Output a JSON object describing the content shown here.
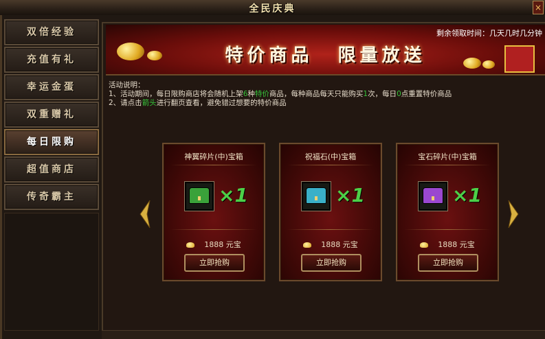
{
  "window": {
    "title": "全民庆典",
    "close_label": "×"
  },
  "sidebar": {
    "items": [
      {
        "label": "双倍经验",
        "active": false
      },
      {
        "label": "充值有礼",
        "active": false
      },
      {
        "label": "幸运金蛋",
        "active": false
      },
      {
        "label": "双重赠礼",
        "active": false
      },
      {
        "label": "每日限购",
        "active": true
      },
      {
        "label": "超值商店",
        "active": false
      },
      {
        "label": "传奇霸主",
        "active": false
      }
    ]
  },
  "banner": {
    "timer_label": "剩余领取时间：几天几时几分钟",
    "title_left": "特价商品",
    "title_right": "限量放送"
  },
  "description": {
    "heading": "活动说明：",
    "line1_a": "1、活动期间，每日限购商店将会随机上架",
    "line1_hl1": "6",
    "line1_b": "种",
    "line1_hl2": "特价",
    "line1_c": "商品，每种商品每天只能购买",
    "line1_hl3": "1",
    "line1_d": "次，每日",
    "line1_hl4": "0",
    "line1_e": "点重置特价商品",
    "line2_a": "2、请点击",
    "line2_hl": "箭头",
    "line2_b": "进行翻页查看，避免错过想要的特价商品"
  },
  "products": [
    {
      "name": "神翼碎片(中)宝箱",
      "qty": "×1",
      "price": "1888  元宝",
      "buy_label": "立即抢购",
      "chest_color": "#3aa23a"
    },
    {
      "name": "祝福石(中)宝箱",
      "qty": "×1",
      "price": "1888  元宝",
      "buy_label": "立即抢购",
      "chest_color": "#3ab0c8"
    },
    {
      "name": "宝石碎片(中)宝箱",
      "qty": "×1",
      "price": "1888  元宝",
      "buy_label": "立即抢购",
      "chest_color": "#9a48d0"
    }
  ],
  "colors": {
    "highlight": "#36c23a",
    "accent_gold": "#d8a020",
    "frame": "#6b4a2c"
  }
}
